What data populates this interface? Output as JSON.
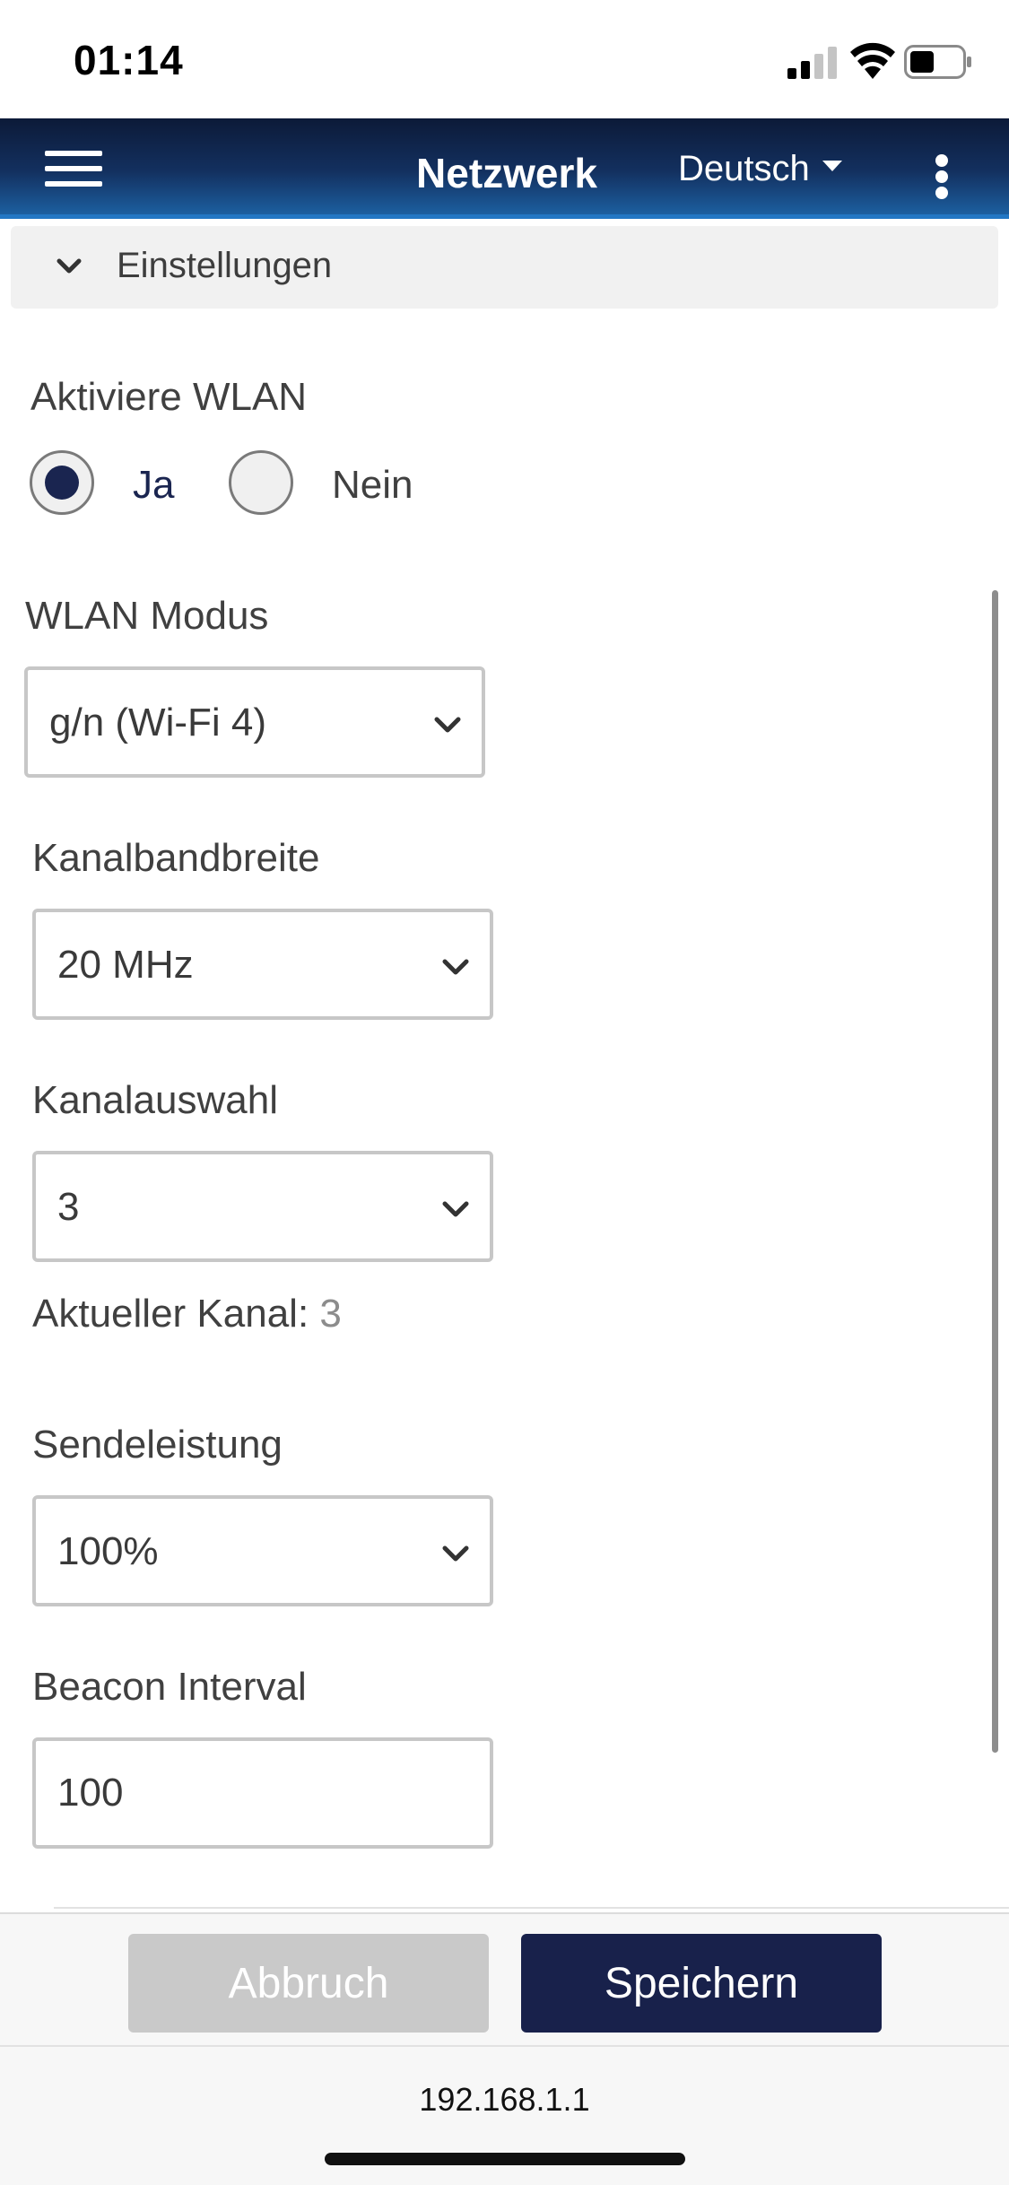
{
  "status_bar": {
    "time": "01:14"
  },
  "header": {
    "title": "Netzwerk",
    "language": "Deutsch"
  },
  "section": {
    "label": "Einstellungen"
  },
  "wlan_enable": {
    "label": "Aktiviere WLAN",
    "option_yes": "Ja",
    "option_no": "Nein",
    "selected": "Ja"
  },
  "wlan_mode": {
    "label": "WLAN Modus",
    "value": "g/n (Wi-Fi 4)"
  },
  "channel_bandwidth": {
    "label": "Kanalbandbreite",
    "value": "20 MHz"
  },
  "channel_selection": {
    "label": "Kanalauswahl",
    "value": "3"
  },
  "current_channel": {
    "label": "Aktueller Kanal:",
    "value": "3"
  },
  "transmit_power": {
    "label": "Sendeleistung",
    "value": "100%"
  },
  "beacon_interval": {
    "label": "Beacon Interval",
    "value": "100"
  },
  "footer": {
    "cancel_label": "Abbruch",
    "save_label": "Speichern"
  },
  "address": {
    "url": "192.168.1.1"
  },
  "colors": {
    "header_dark": "#0c1a38",
    "header_light": "#1c5fa0",
    "accent": "#18214b",
    "disabled_button": "#c9c9c9"
  }
}
